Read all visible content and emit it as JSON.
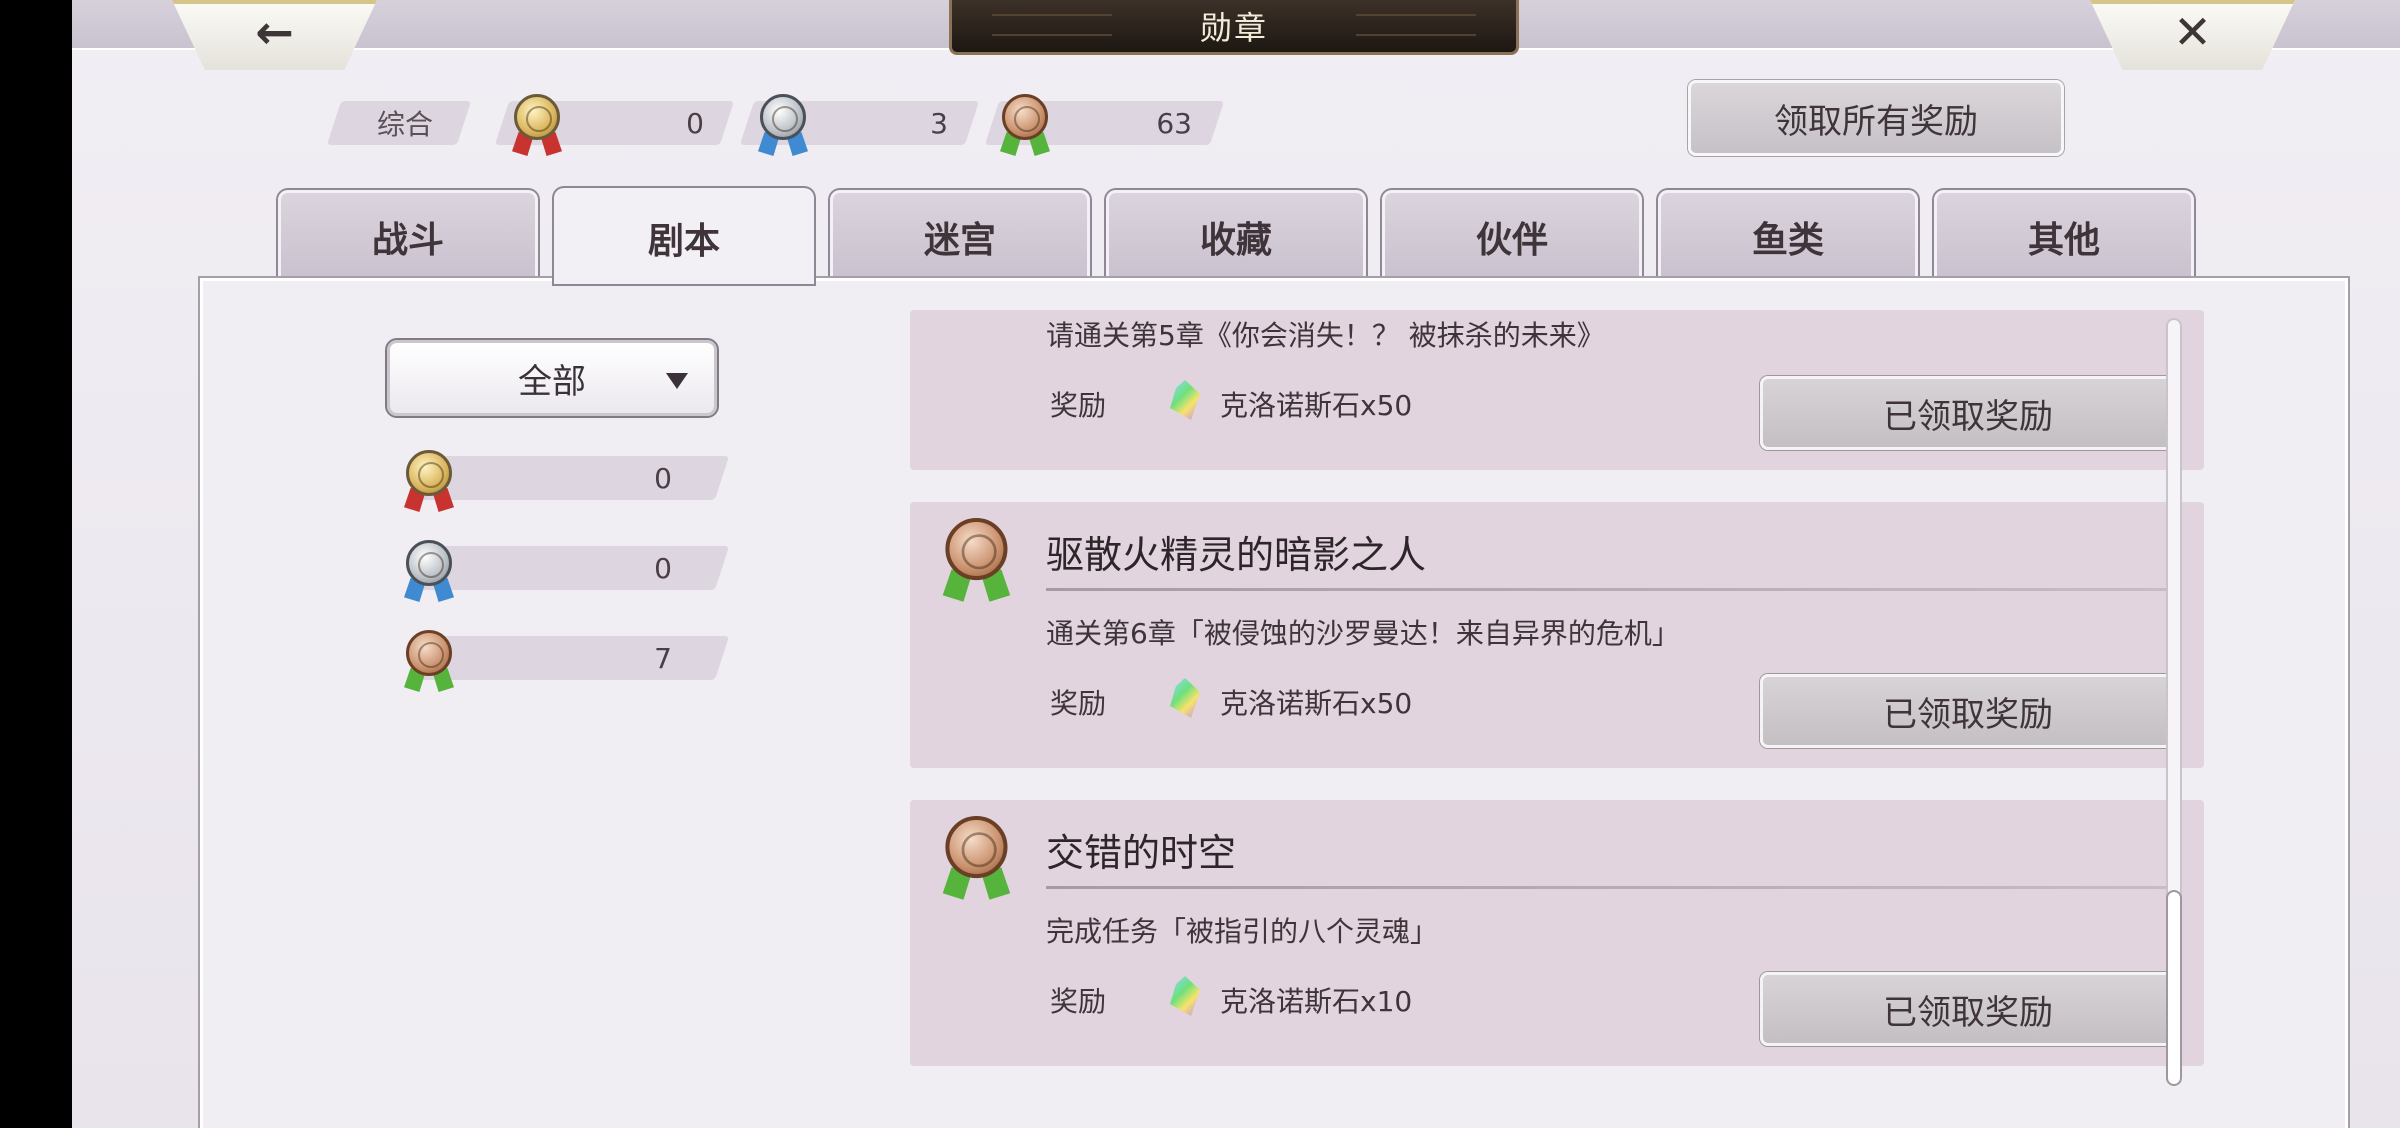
{
  "header": {
    "title": "勋章",
    "back_icon": "←",
    "close_icon": "✕"
  },
  "summary": {
    "label": "综合",
    "gold": "0",
    "silver": "3",
    "bronze": "63"
  },
  "claim_all_label": "领取所有奖励",
  "tabs": [
    {
      "label": "战斗",
      "active": false
    },
    {
      "label": "剧本",
      "active": true
    },
    {
      "label": "迷宫",
      "active": false
    },
    {
      "label": "收藏",
      "active": false
    },
    {
      "label": "伙伴",
      "active": false
    },
    {
      "label": "鱼类",
      "active": false
    },
    {
      "label": "其他",
      "active": false
    }
  ],
  "filter": {
    "selected": "全部",
    "counts": {
      "gold": "0",
      "silver": "0",
      "bronze": "7"
    }
  },
  "cards": [
    {
      "title": "",
      "desc": "请通关第5章《你会消失！？ 被抹杀的未来》",
      "reward_label": "奖励",
      "reward": "克洛诺斯石x50",
      "button": "已领取奖励",
      "medal": "bronze"
    },
    {
      "title": "驱散火精灵的暗影之人",
      "desc": "通关第6章「被侵蚀的沙罗曼达！来自异界的危机」",
      "reward_label": "奖励",
      "reward": "克洛诺斯石x50",
      "button": "已领取奖励",
      "medal": "bronze"
    },
    {
      "title": "交错的时空",
      "desc": "完成任务「被指引的八个灵魂」",
      "reward_label": "奖励",
      "reward": "克洛诺斯石x10",
      "button": "已领取奖励",
      "medal": "bronze"
    }
  ],
  "colors": {
    "bronze_ribbon": "#56b33c",
    "silver_ribbon": "#3f8ad0",
    "gold_ribbon": "#c8332f",
    "title_plate": "#2a221b"
  }
}
